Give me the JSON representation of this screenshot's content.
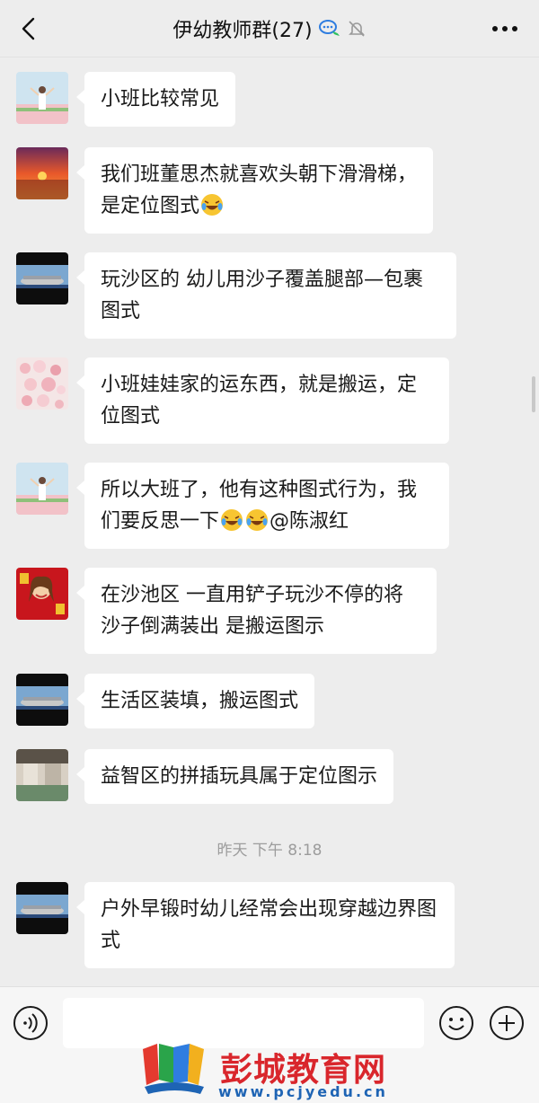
{
  "header": {
    "title": "伊幼教师群(27)",
    "back_icon": "chevron-left-icon",
    "more_icon": "more-dots-icon"
  },
  "messages": [
    {
      "text": "小班比较常见",
      "avatar": "avatar-girl-field"
    },
    {
      "text_before": "我们班董思杰就喜欢头朝下滑滑梯，是定位图式",
      "emojis": 1,
      "avatar": "avatar-sunset"
    },
    {
      "text": "玩沙区的 幼儿用沙子覆盖腿部—包裹图式",
      "avatar": "avatar-stadium"
    },
    {
      "text": "小班娃娃家的运东西，就是搬运，定位图式",
      "avatar": "avatar-flowers"
    },
    {
      "text_before": "所以大班了，他有这种图式行为，我们要反思一下",
      "text_after": "@陈淑红",
      "emojis": 2,
      "avatar": "avatar-girl-field"
    },
    {
      "text": "在沙池区 一直用铲子玩沙不停的将沙子倒满装出 是搬运图示",
      "avatar": "avatar-cartoon-girl"
    },
    {
      "text": "生活区装填，搬运图式",
      "avatar": "avatar-stadium"
    },
    {
      "text": "益智区的拼插玩具属于定位图示",
      "avatar": "avatar-room"
    },
    {
      "text": "户外早锻时幼儿经常会出现穿越边界图式",
      "avatar": "avatar-stadium"
    }
  ],
  "timestamp": "昨天 下午 8:18",
  "input": {
    "value": "",
    "placeholder": ""
  },
  "watermark": {
    "name": "彭城教育网",
    "url": "www.pcjyedu.cn"
  },
  "colors": {
    "background": "#ededed",
    "bubble": "#ffffff",
    "accent_blue": "#1e64b4",
    "watermark_red": "#d9262c"
  }
}
